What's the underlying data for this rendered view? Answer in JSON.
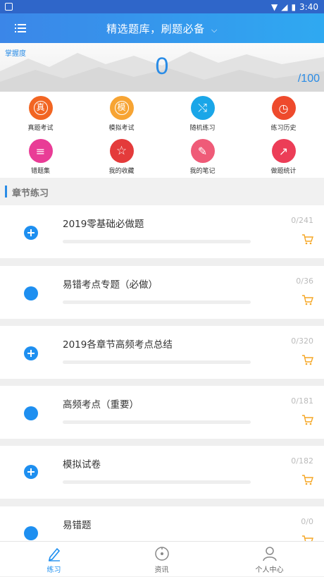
{
  "status_bar": {
    "time": "3:40"
  },
  "header": {
    "title": "精选题库，刷题必备"
  },
  "hero": {
    "mastery_label": "掌握度",
    "score": "0",
    "total": "/100"
  },
  "grid": [
    {
      "label": "真题考试",
      "color": "#f26522",
      "glyph": "真",
      "icon": "exam-icon"
    },
    {
      "label": "模拟考试",
      "color": "#f7a433",
      "glyph": "模",
      "icon": "mock-exam-icon"
    },
    {
      "label": "随机练习",
      "color": "#1aa6e8",
      "glyph": "⤭",
      "icon": "shuffle-icon"
    },
    {
      "label": "练习历史",
      "color": "#ee4a2c",
      "glyph": "◷",
      "icon": "history-icon"
    },
    {
      "label": "错题集",
      "color": "#e93c96",
      "glyph": "≡",
      "icon": "wrong-questions-icon"
    },
    {
      "label": "我的收藏",
      "color": "#e43b3b",
      "glyph": "☆",
      "icon": "star-icon"
    },
    {
      "label": "我的笔记",
      "color": "#ef5b78",
      "glyph": "✎",
      "icon": "pencil-icon"
    },
    {
      "label": "做题统计",
      "color": "#ec3d57",
      "glyph": "↗",
      "icon": "statistics-icon"
    }
  ],
  "section": {
    "title": "章节练习"
  },
  "chapters": [
    {
      "name": "2019零基础必做题",
      "count": "0/241",
      "icon": "plus"
    },
    {
      "name": "易错考点专题（必做）",
      "count": "0/36",
      "icon": "dot"
    },
    {
      "name": "2019各章节高频考点总结",
      "count": "0/320",
      "icon": "plus"
    },
    {
      "name": "高频考点（重要）",
      "count": "0/181",
      "icon": "dot"
    },
    {
      "name": "模拟试卷",
      "count": "0/182",
      "icon": "plus"
    },
    {
      "name": "易错题",
      "count": "0/0",
      "icon": "dot"
    }
  ],
  "tabs": [
    {
      "label": "练习",
      "active": true,
      "icon": "pencil-icon"
    },
    {
      "label": "资讯",
      "active": false,
      "icon": "news-icon"
    },
    {
      "label": "个人中心",
      "active": false,
      "icon": "user-icon"
    }
  ],
  "colors": {
    "accent": "#1e8ff0",
    "cart": "#f5a623"
  }
}
